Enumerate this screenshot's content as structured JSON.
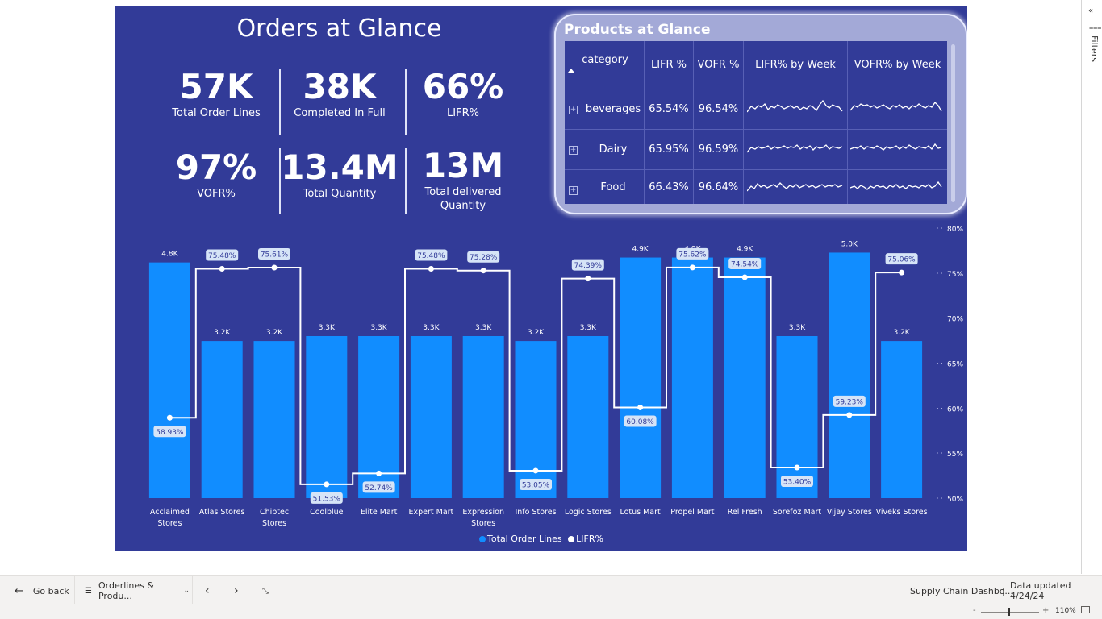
{
  "report": {
    "title": "Orders at Glance",
    "kpis": [
      {
        "value": "57K",
        "label": "Total Order Lines"
      },
      {
        "value": "38K",
        "label": "Completed In Full"
      },
      {
        "value": "66%",
        "label": "LIFR%"
      },
      {
        "value": "97%",
        "label": "VOFR%"
      },
      {
        "value": "13.4M",
        "label": "Total Quantity"
      },
      {
        "value": "13M",
        "label": "Total delivered",
        "label2": "Quantity"
      }
    ]
  },
  "products": {
    "title": "Products at Glance",
    "columns": [
      "category",
      "LIFR %",
      "VOFR %",
      "LIFR% by Week",
      "VOFR% by Week"
    ],
    "sort_icon": "triangle-up-icon",
    "rows": [
      {
        "category": "beverages",
        "lifr": "65.54%",
        "vofr": "96.54%"
      },
      {
        "category": "Dairy",
        "lifr": "65.95%",
        "vofr": "96.59%"
      },
      {
        "category": "Food",
        "lifr": "66.43%",
        "vofr": "96.64%"
      }
    ],
    "expand_icon": "plus-box-icon"
  },
  "chart_data": {
    "type": "bar",
    "categories": [
      "Acclaimed Stores",
      "Atlas Stores",
      "Chiptec Stores",
      "Coolblue",
      "Elite Mart",
      "Expert Mart",
      "Expression Stores",
      "Info Stores",
      "Logic Stores",
      "Lotus Mart",
      "Propel Mart",
      "Rel Fresh",
      "Sorefoz Mart",
      "Vijay Stores",
      "Viveks Stores"
    ],
    "series": [
      {
        "name": "Total Order Lines",
        "type": "bar",
        "axis": "left",
        "color": "#118dff",
        "values": [
          4.8,
          3.2,
          3.2,
          3.3,
          3.3,
          3.3,
          3.3,
          3.2,
          3.3,
          4.9,
          4.9,
          4.9,
          3.3,
          5.0,
          3.2
        ],
        "labels": [
          "4.8K",
          "3.2K",
          "3.2K",
          "3.3K",
          "3.3K",
          "3.3K",
          "3.3K",
          "3.2K",
          "3.3K",
          "4.9K",
          "4.9K",
          "4.9K",
          "3.3K",
          "5.0K",
          "3.2K"
        ]
      },
      {
        "name": "LIFR%",
        "type": "step-line",
        "axis": "right",
        "color": "#ffffff",
        "values": [
          58.93,
          75.48,
          75.61,
          51.53,
          52.74,
          75.48,
          75.28,
          53.05,
          74.39,
          60.08,
          75.62,
          74.54,
          53.4,
          59.23,
          75.06
        ],
        "labels": [
          "58.93%",
          "75.48%",
          "75.61%",
          "51.53%",
          "52.74%",
          "75.48%",
          "75.28%",
          "53.05%",
          "74.39%",
          "60.08%",
          "75.62%",
          "74.54%",
          "53.40%",
          "59.23%",
          "75.06%"
        ]
      }
    ],
    "left_ylim": [
      0,
      5.5
    ],
    "right_ylim": [
      50,
      80
    ],
    "right_ticks": [
      "50%",
      "55%",
      "60%",
      "65%",
      "70%",
      "75%",
      "80%"
    ],
    "legend": {
      "position": "bottom-center",
      "items": [
        "Total Order Lines",
        "LIFR%"
      ]
    }
  },
  "bottom": {
    "back_label": "Go back",
    "page_label": "Orderlines & Produ...",
    "report_name": "Supply Chain Dashbo...",
    "updated": "Data updated 4/24/24",
    "zoom": "110%"
  },
  "filters": {
    "label": "Filters"
  }
}
